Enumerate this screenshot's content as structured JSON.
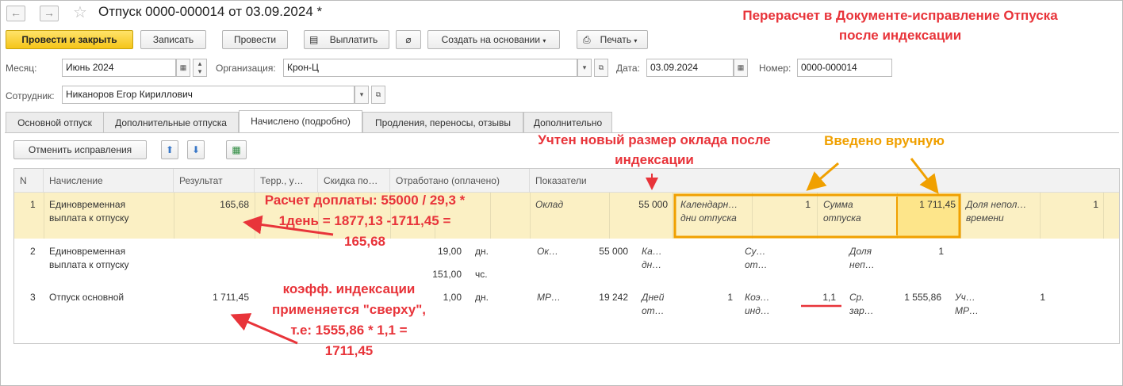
{
  "window": {
    "title": "Отпуск 0000-000014 от 03.09.2024 *"
  },
  "toolbar": {
    "post_close": "Провести и закрыть",
    "save": "Записать",
    "post": "Провести",
    "pay": "Выплатить",
    "create_based": "Создать на основании",
    "print": "Печать"
  },
  "form": {
    "month_label": "Месяц:",
    "month_value": "Июнь 2024",
    "org_label": "Организация:",
    "org_value": "Крон-Ц",
    "date_label": "Дата:",
    "date_value": "03.09.2024",
    "number_label": "Номер:",
    "number_value": "0000-000014",
    "employee_label": "Сотрудник:",
    "employee_value": "Никаноров Егор Кириллович"
  },
  "tabs": [
    "Основной отпуск",
    "Дополнительные отпуска",
    "Начислено (подробно)",
    "Продления, переносы, отзывы",
    "Дополнительно"
  ],
  "grid_toolbar": {
    "cancel_corrections": "Отменить исправления"
  },
  "table": {
    "headers": [
      "N",
      "Начисление",
      "Результат",
      "Терр., у…",
      "Скидка по…",
      "Отработано (оплачено)",
      "Показатели"
    ],
    "rows": [
      {
        "n": "1",
        "accrual_line1": "Единовременная",
        "accrual_line2": "выплата к отпуску",
        "result": "165,68",
        "ind1_name": "Оклад",
        "ind1_value": "55 000",
        "ind2_name_line1": "Календарн…",
        "ind2_name_line2": "дни отпуска",
        "ind2_value": "1",
        "ind3_name_line1": "Сумма",
        "ind3_name_line2": "отпуска",
        "ind3_value": "1 711,45",
        "ind4_name_line1": "Доля непол…",
        "ind4_name_line2": "времени",
        "ind4_value": "1"
      },
      {
        "n": "2",
        "accrual_line1": "Единовременная",
        "accrual_line2": "выплата к отпуску",
        "worked1": "19,00",
        "unit1": "дн.",
        "worked2": "151,00",
        "unit2": "чс.",
        "ind1_name": "Ок…",
        "ind1_value": "55 000",
        "ind2_name_line1": "Ка…",
        "ind2_name_line2": "дн…",
        "ind3_name_line1": "Су…",
        "ind3_name_line2": "от…",
        "ind4_name_line1": "Доля",
        "ind4_name_line2": "неп…",
        "ind4_value": "1"
      },
      {
        "n": "3",
        "accrual_line1": "Отпуск основной",
        "result": "1 711,45",
        "worked1": "1,00",
        "unit1": "дн.",
        "ind1_name": "МР…",
        "ind1_value": "19 242",
        "ind2_name_line1": "Дней",
        "ind2_name_line2": "от…",
        "ind2_value": "1",
        "ind3_name_line1": "Коэ…",
        "ind3_name_line2": "инд…",
        "ind3_value": "1,1",
        "ind4_name_line1": "Ср.",
        "ind4_name_line2": "зар…",
        "ind4_value": "1 555,86",
        "ind5_name_line1": "Уч…",
        "ind5_name_line2": "МР…",
        "ind5_value": "1"
      }
    ]
  },
  "annotations": {
    "top_title_line1": "Перерасчет в Документе-исправление Отпуска",
    "top_title_line2": "после индексации",
    "salary_line1": "Учтен новый размер оклада после",
    "salary_line2": "индексации",
    "manual": "Введено вручную",
    "calc_line1": "Расчет доплаты: 55000 / 29,3 *",
    "calc_line2": "1день = 1877,13 -1711,45 =",
    "calc_line3": "165,68",
    "coef_line1": "коэфф. индексации",
    "coef_line2": "применяется \"сверху\",",
    "coef_line3": "т.е: 1555,86 * 1,1 =",
    "coef_line4": "1711,45"
  },
  "colors": {
    "annotation_red": "#e8343a",
    "annotation_orange": "#f0a000",
    "highlight_row": "#fbf0c4",
    "primary_button": "#f5c518"
  }
}
